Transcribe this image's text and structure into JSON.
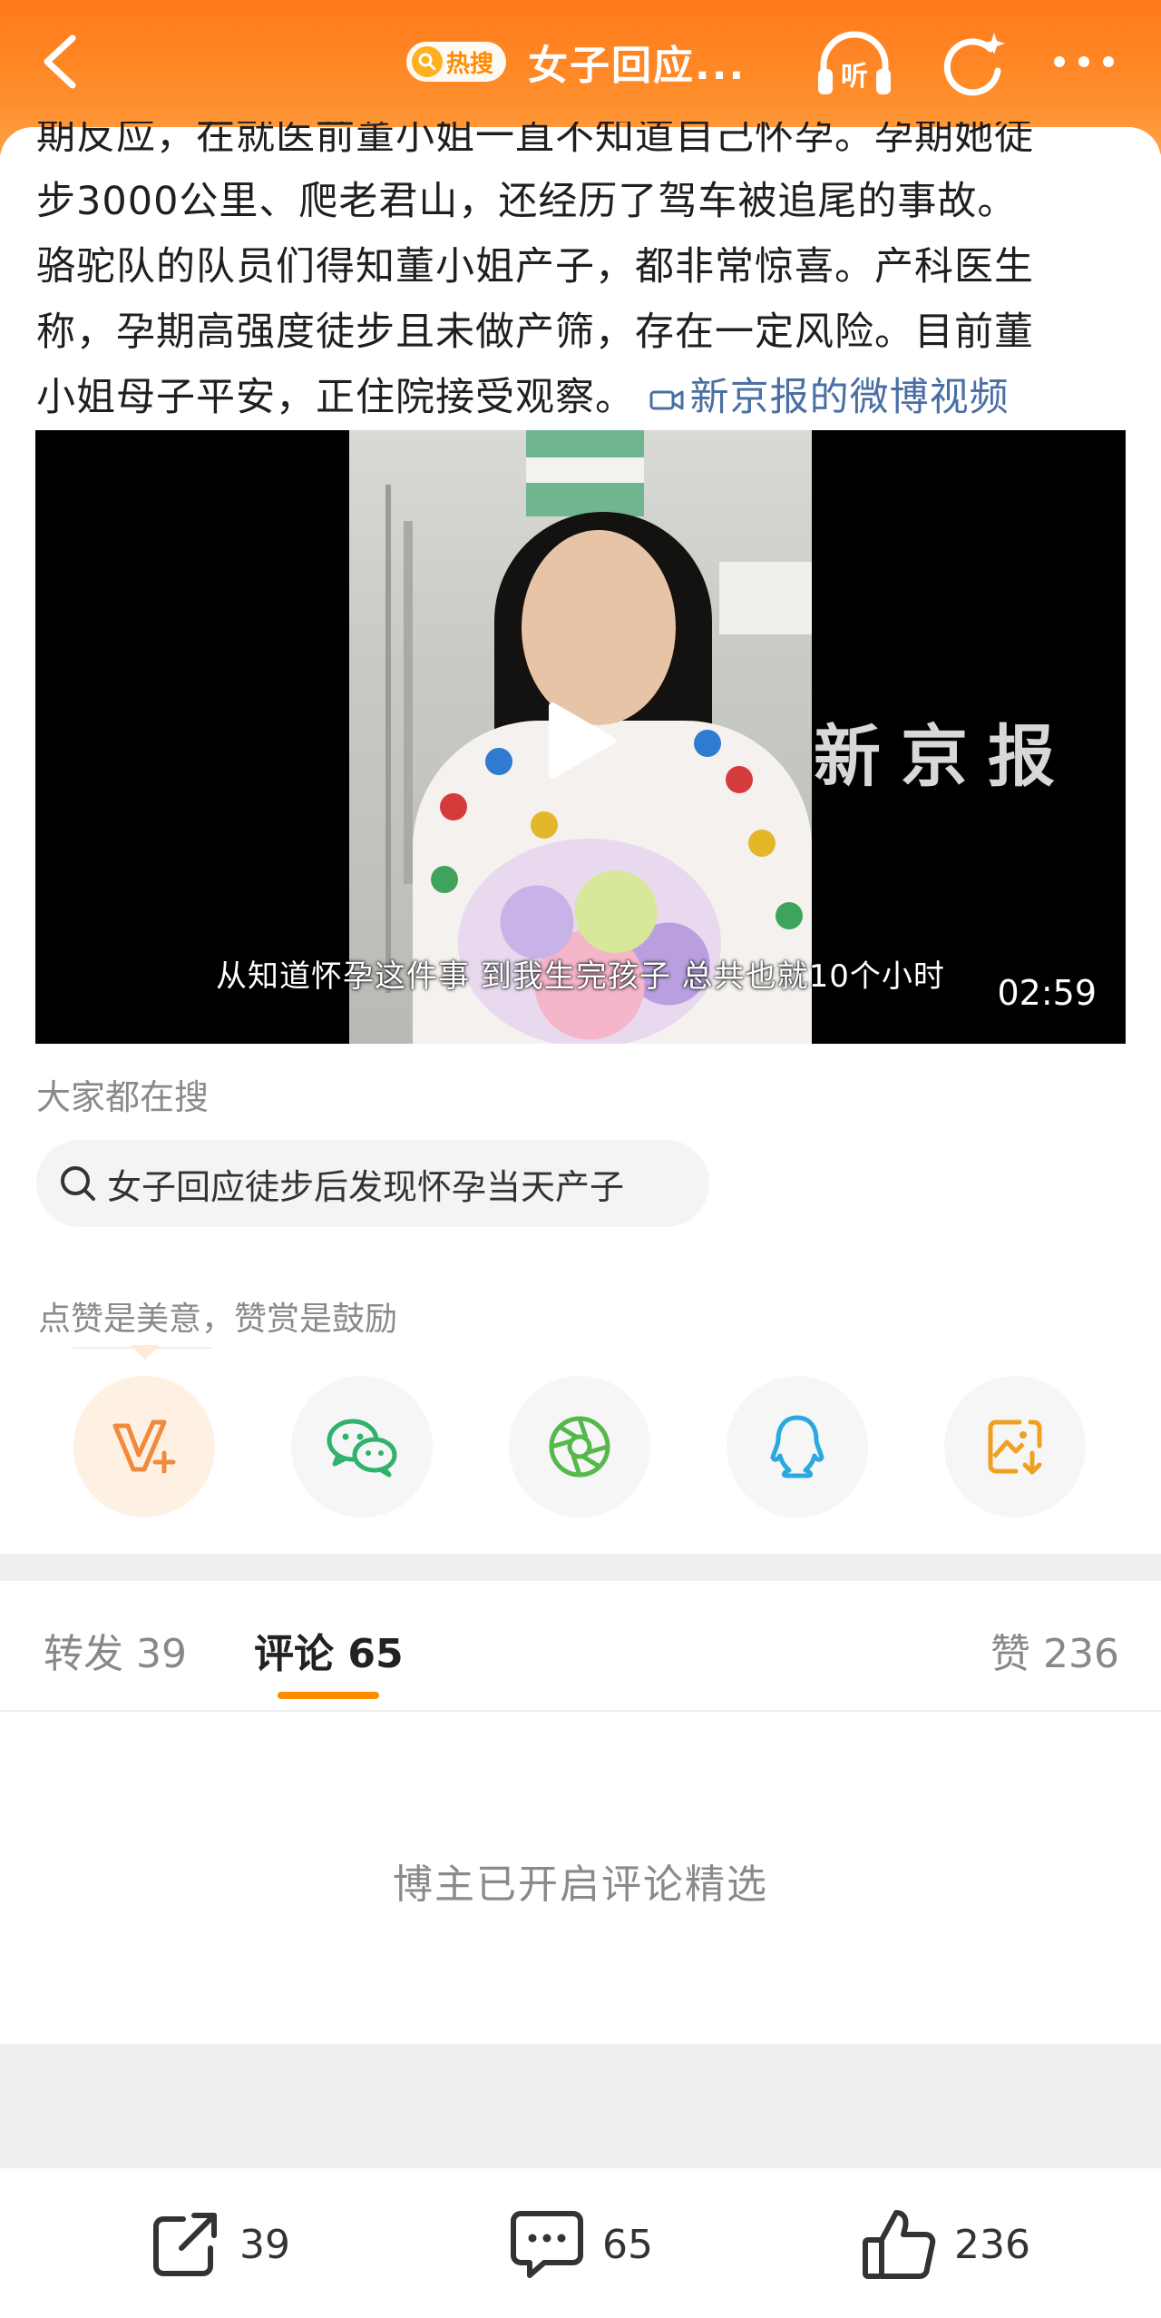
{
  "header": {
    "back_icon": "back-arrow-icon",
    "hot_badge": "热搜",
    "title": "女子回应...",
    "listen_label": "听",
    "colors": {
      "header_orange": "#ff7a1c",
      "accent": "#ff8a00"
    }
  },
  "post": {
    "lines": [
      "期反应，在就医前董小姐一直不知道自己怀孕。孕期她徒",
      "步3000公里、爬老君山，还经历了驾车被追尾的事故。",
      "骆驼队的队员们得知董小姐产子，都非常惊喜。产科医生",
      "称，孕期高强度徒步且未做产筛，存在一定风险。目前董"
    ],
    "last_line": "小姐母子平安，正住院接受观察。",
    "video_link": "新京报的微博视频",
    "link_color": "#4a6fa5"
  },
  "video": {
    "watermark": "新京报",
    "caption": "从知道怀孕这件事 到我生完孩子 总共也就10个小时",
    "duration": "02:59"
  },
  "search": {
    "heading": "大家都在搜",
    "query": "女子回应徒步后发现怀孕当天产子"
  },
  "tip": "点赞是美意，赞赏是鼓励",
  "share": [
    {
      "name": "reward-icon",
      "label": "V+"
    },
    {
      "name": "wechat-icon"
    },
    {
      "name": "moments-icon"
    },
    {
      "name": "qq-icon"
    },
    {
      "name": "save-image-icon"
    }
  ],
  "tabs": {
    "repost": {
      "label": "转发",
      "count": "39"
    },
    "comment": {
      "label": "评论",
      "count": "65"
    },
    "like": {
      "label": "赞",
      "count": "236"
    }
  },
  "comment_notice": "博主已开启评论精选",
  "bottom_bar": {
    "repost_count": "39",
    "comment_count": "65",
    "like_count": "236"
  }
}
